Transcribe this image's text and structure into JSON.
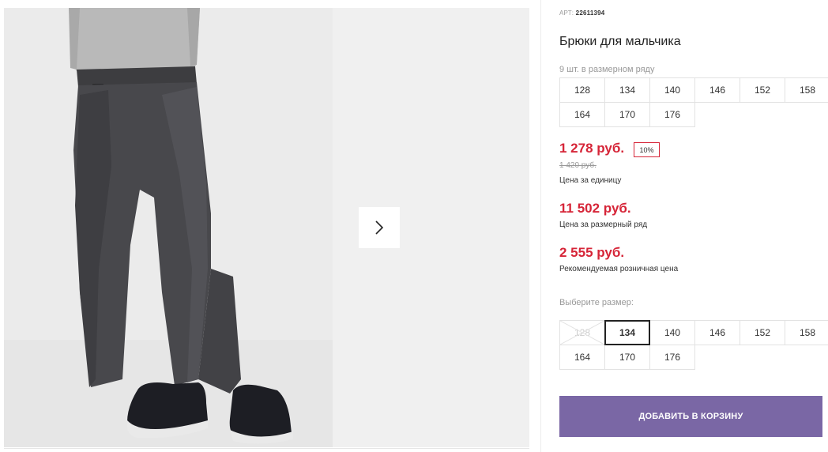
{
  "product": {
    "art_label": "АРТ:",
    "art_number": "22611394",
    "title": "Брюки для мальчика",
    "row_count": "9 шт. в размерном ряду",
    "size_row": [
      "128",
      "134",
      "140",
      "146",
      "152",
      "158",
      "164",
      "170",
      "176"
    ]
  },
  "pricing": {
    "unit_price": "1 278 руб.",
    "discount": "10%",
    "old_price": "1 420 руб.",
    "unit_caption": "Цена за единицу",
    "row_price": "11 502 руб.",
    "row_caption": "Цена за размерный ряд",
    "retail_price": "2 555 руб.",
    "retail_caption": "Рекомендуемая розничная цена"
  },
  "size_picker": {
    "label": "Выберите размер:",
    "sizes": [
      "128",
      "134",
      "140",
      "146",
      "152",
      "158",
      "164",
      "170",
      "176"
    ],
    "selected": "134",
    "unavailable": [
      "128"
    ]
  },
  "cart": {
    "button_label": "ДОБАВИТЬ В КОРЗИНУ"
  },
  "colors": {
    "price": "#d62538",
    "button": "#7a67a5",
    "photo_bg": "#ebebeb"
  },
  "icons": {
    "next": "chevron-right-icon",
    "unavailable_size": "cross-out-icon"
  }
}
